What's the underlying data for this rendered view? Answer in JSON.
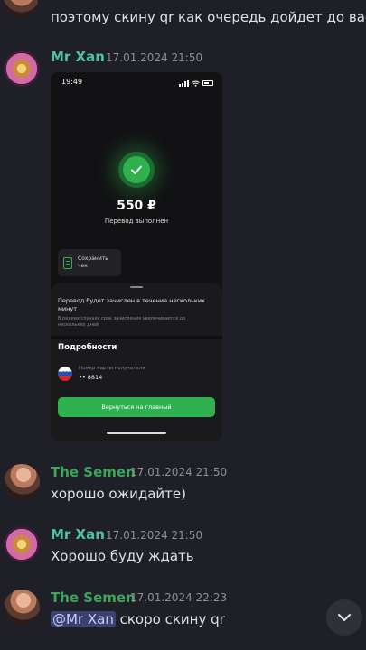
{
  "messages": {
    "top_text": "поэтому скину qr как очередь дойдет до вас",
    "m1": {
      "author": "Mr Xan",
      "time": "17.01.2024 21:50"
    },
    "m2": {
      "author": "The Semen",
      "time": "17.01.2024 21:50",
      "text": "хорошо ожидайте)"
    },
    "m3": {
      "author": "Mr Xan",
      "time": "17.01.2024 21:50",
      "text": "Хорошо буду ждать"
    },
    "m4": {
      "author": "The Semen",
      "time": "17.01.2024 22:23",
      "mention": "@Mr Xan",
      "text": " скоро скину qr"
    }
  },
  "screenshot": {
    "status_time": "19:49",
    "amount": "550 ₽",
    "amount_caption": "Перевод выполнен",
    "save_receipt": "Сохранить чек",
    "info_title": "Перевод будет зачислен в течение нескольких минут",
    "info_sub": "В редких случаях срок зачисления увеличивается до нескольких дней",
    "details_title": "Подробности",
    "card_label": "Номер карты получателя",
    "card_number": "•• 8814",
    "home_button": "Вернуться на главный"
  },
  "colors": {
    "background": "#1e1f27",
    "author_semen": "#3ba55c",
    "author_xan": "#4fc3a1",
    "accent_green": "#2fb14f",
    "mention_bg": "#3c4270"
  },
  "icons": [
    "check-icon",
    "receipt-icon",
    "russia-flag-icon",
    "chevron-down-icon",
    "location-arrow-icon",
    "wifi-icon",
    "battery-icon"
  ]
}
